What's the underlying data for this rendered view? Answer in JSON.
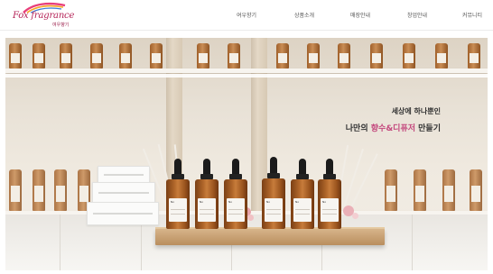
{
  "header": {
    "logo": {
      "brand": "Fox fragrance",
      "sub": "여우향기",
      "accent_color": "#b52458",
      "swoosh_colors": [
        "#e83e7a",
        "#f6a623",
        "#3a7bd5"
      ]
    },
    "nav": [
      {
        "label": "여우향기"
      },
      {
        "label": "상품소개"
      },
      {
        "label": "매장안내"
      },
      {
        "label": "창업안내"
      },
      {
        "label": "커뮤니티"
      }
    ]
  },
  "hero": {
    "headline_line1": "세상에 하나뿐인",
    "headline_line2_prefix": "나만의 ",
    "headline_line2_accent": "향수&디퓨저",
    "headline_line2_suffix": " 만들기",
    "accent_color": "#c4487d",
    "bottle_label": "No"
  }
}
